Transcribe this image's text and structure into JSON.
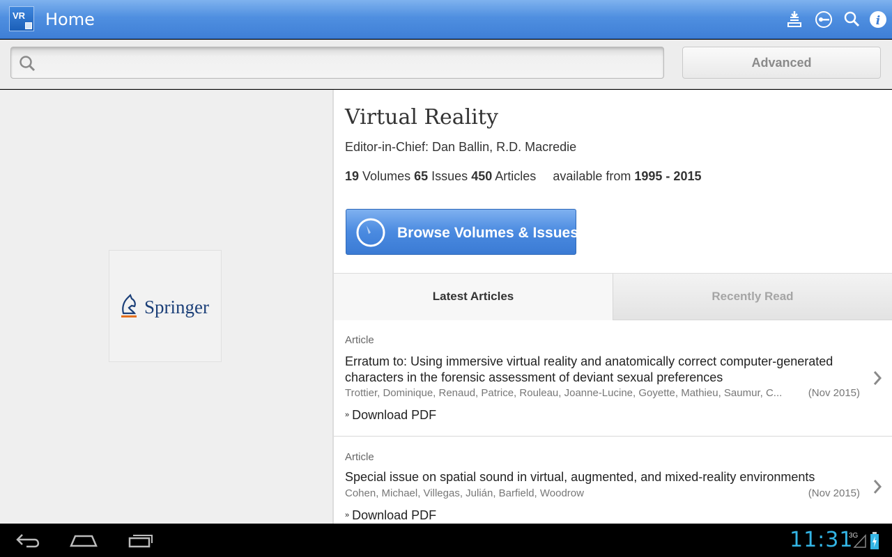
{
  "app": {
    "icon_text": "VR",
    "title": "Home"
  },
  "actionbar_icons": [
    "download-icon",
    "key-icon",
    "search-icon",
    "info-icon"
  ],
  "search": {
    "value": "",
    "placeholder": "",
    "advanced_label": "Advanced"
  },
  "publisher": {
    "logo_text": "Springer"
  },
  "journal": {
    "title": "Virtual Reality",
    "editor": "Editor-in-Chief: Dan Ballin, R.D. Macredie",
    "volumes_count": "19",
    "volumes_label": "Volumes",
    "issues_count": "65",
    "issues_label": "Issues",
    "articles_count": "450",
    "articles_label": "Articles",
    "available_label": "available from",
    "year_range": "1995 - 2015",
    "browse_label": "Browse Volumes & Issues"
  },
  "tabs": [
    {
      "label": "Latest Articles",
      "active": true
    },
    {
      "label": "Recently Read",
      "active": false
    }
  ],
  "articles": [
    {
      "type": "Article",
      "title": "Erratum to: Using immersive virtual reality and anatomically correct computer-generated characters in the forensic assessment of deviant sexual preferences",
      "authors": "Trottier, Dominique, Renaud, Patrice, Rouleau, Joanne-Lucine, Goyette, Mathieu, Saumur, C...",
      "date": "(Nov 2015)",
      "download": "Download PDF"
    },
    {
      "type": "Article",
      "title": "Special issue on spatial sound in virtual, augmented, and mixed-reality environments",
      "authors": "Cohen, Michael, Villegas, Julián, Barfield, Woodrow",
      "date": "(Nov 2015)",
      "download": "Download PDF"
    }
  ],
  "statusbar": {
    "time": "11:31",
    "network": "3G"
  },
  "colors": {
    "actionbar": "#4f8fe0",
    "accent_clock": "#33b5e5",
    "button_blue": "#4a8ae0"
  }
}
